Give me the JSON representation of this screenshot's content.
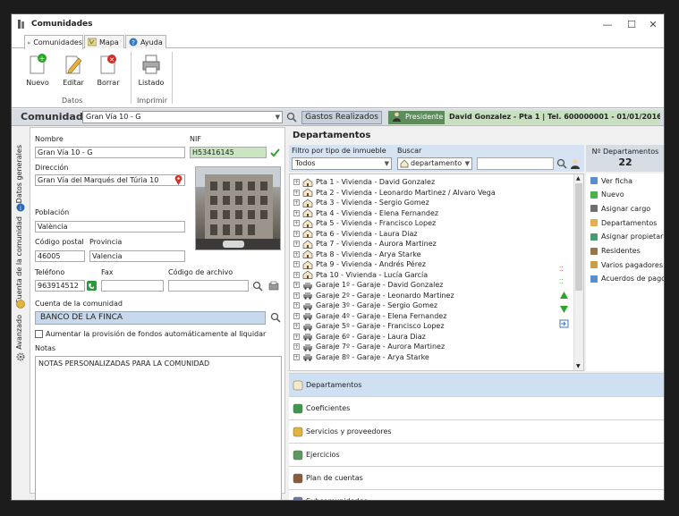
{
  "window": {
    "title": "Comunidades"
  },
  "tabs": [
    {
      "label": "Comunidades",
      "icon": "building-icon"
    },
    {
      "label": "Mapa",
      "icon": "map-icon"
    },
    {
      "label": "Ayuda",
      "icon": "help-icon"
    }
  ],
  "ribbon": {
    "nuevo": "Nuevo",
    "editar": "Editar",
    "borrar": "Borrar",
    "listado": "Listado",
    "group_datos": "Datos",
    "group_imprimir": "Imprimir"
  },
  "comunidad_bar": {
    "label": "Comunidad",
    "selected": "Gran Vía 10 - G",
    "gastos": "Gastos Realizados",
    "presidente": "Presidente",
    "presidente_info": "David Gonzalez - Pta 1 | Tel. 600000001 - 01/01/2016"
  },
  "vertical_tabs": [
    "Datos generales",
    "Cuenta de la comunidad",
    "Avanzado"
  ],
  "form": {
    "nombre_label": "Nombre",
    "nombre": "Gran Vía 10 - G",
    "nif_label": "NIF",
    "nif": "H53416145",
    "direccion_label": "Dirección",
    "direccion": "Gran Vía del Marqués del Túria 10",
    "poblacion_label": "Población",
    "poblacion": "València",
    "cp_label": "Código postal",
    "cp": "46005",
    "provincia_label": "Provincia",
    "provincia": "Valencia",
    "telefono_label": "Teléfono",
    "telefono": "963914512",
    "fax_label": "Fax",
    "fax": "",
    "archivo_label": "Código de archivo",
    "archivo": "",
    "cuenta_label": "Cuenta de la comunidad",
    "cuenta": "BANCO DE LA FINCA",
    "aumentar_label": "Aumentar la provisión de fondos automáticamente al liquidar",
    "notas_label": "Notas",
    "notas": "NOTAS PERSONALIZADAS PARA LA COMUNIDAD"
  },
  "departamentos": {
    "header": "Departamentos",
    "filtro_label": "Filtro por tipo de inmueble",
    "filtro": "Todos",
    "buscar_label": "Buscar",
    "buscar_tipo": "departamento",
    "buscar_valor": "",
    "num_label": "Nº Departamentos",
    "num": "22",
    "items": [
      "Pta 1 - Vivienda - David Gonzalez",
      "Pta 2 - Vivienda - Leonardo Martinez / Alvaro Vega",
      "Pta 3 - Vivienda - Sergio Gomez",
      "Pta 4 - Vivienda - Elena Fernandez",
      "Pta 5 - Vivienda - Francisco Lopez",
      "Pta 6 - Vivienda - Laura Diaz",
      "Pta 7 - Vivienda - Aurora Martinez",
      "Pta 8 - Vivienda - Arya Starke",
      "Pta 9 - Vivienda - Andrés Pérez",
      "Pta 10 - Vivienda - Lucía García",
      "Garaje 1º - Garaje - David Gonzalez",
      "Garaje 2º - Garaje - Leonardo Martinez",
      "Garaje 3º - Garaje - Sergio Gomez",
      "Garaje 4º - Garaje - Elena Fernandez",
      "Garaje 5º - Garaje - Francisco Lopez",
      "Garaje 6º - Garaje - Laura Diaz",
      "Garaje 7º - Garaje - Aurora Martinez",
      "Garaje 8º - Garaje - Arya Starke"
    ],
    "actions": [
      "Ver ficha",
      "Nuevo",
      "Asignar cargo",
      "Departamentos",
      "Asignar propietario",
      "Residentes",
      "Varios pagadores",
      "Acuerdos de pago"
    ]
  },
  "accordion": [
    "Departamentos",
    "Coeficientes",
    "Servicios y proveedores",
    "Ejercicios",
    "Plan de cuentas",
    "Subcomunidades"
  ],
  "colors": {
    "accent": "#cfe0f3",
    "presidente": "#5b8c5a",
    "nif_bg": "#c9e6c0",
    "cuenta_bg": "#c7d8ea"
  }
}
